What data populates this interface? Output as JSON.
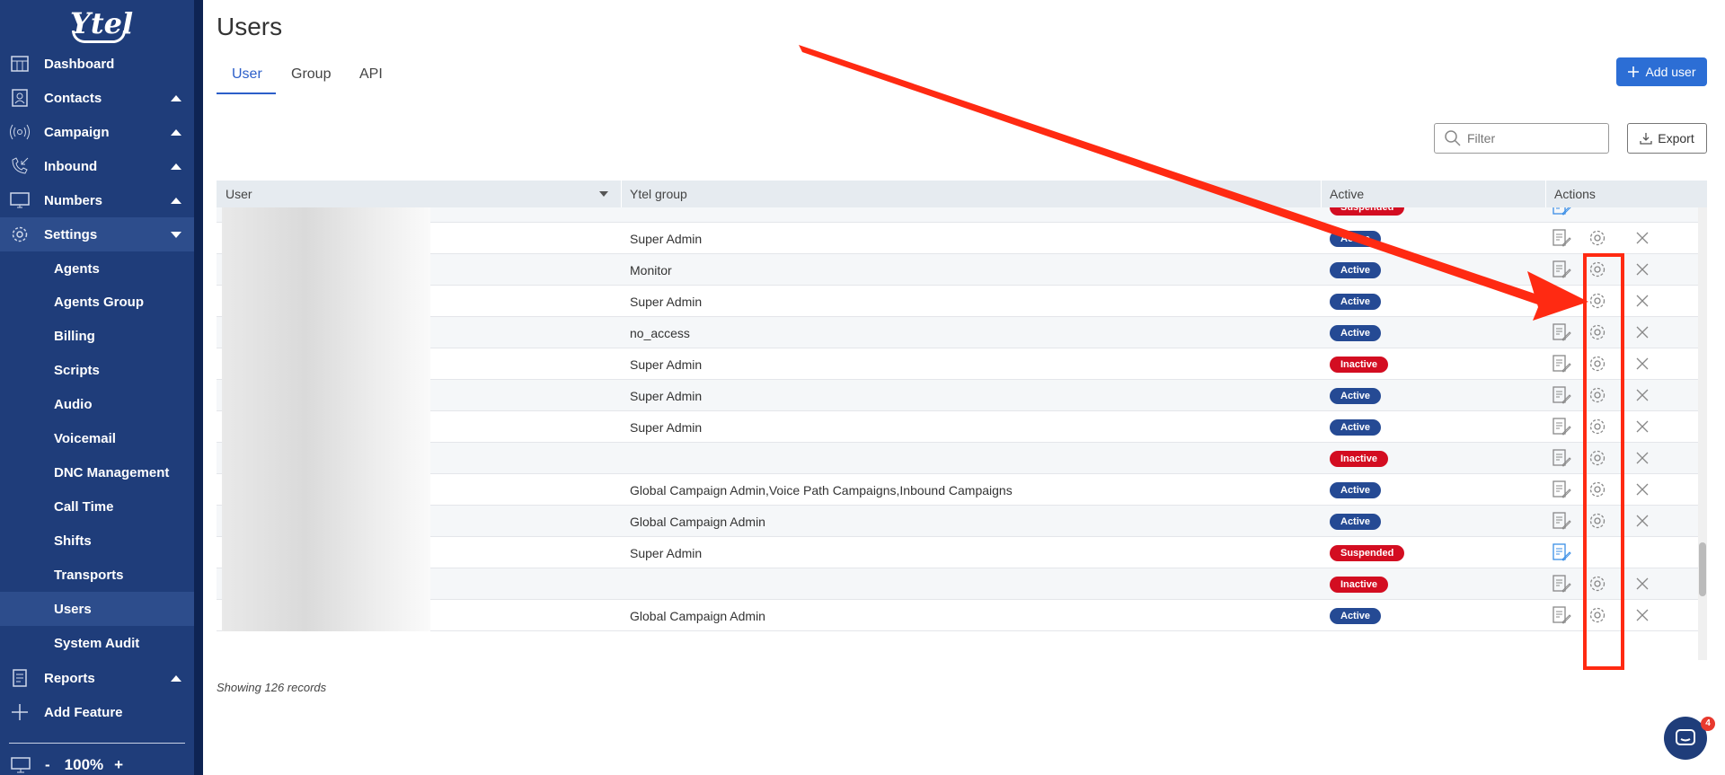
{
  "app": {
    "logo_text": "Ytel"
  },
  "sidebar": {
    "items": [
      {
        "label": "Dashboard",
        "icon": "dashboard-icon"
      },
      {
        "label": "Contacts",
        "icon": "contacts-icon"
      },
      {
        "label": "Campaign",
        "icon": "broadcast-icon"
      },
      {
        "label": "Inbound",
        "icon": "phone-incoming-icon"
      },
      {
        "label": "Numbers",
        "icon": "numbers-icon"
      },
      {
        "label": "Settings",
        "icon": "gear-icon"
      },
      {
        "label": "Reports",
        "icon": "reports-icon"
      },
      {
        "label": "Add Feature",
        "icon": "plus-icon"
      }
    ],
    "settings_sub": [
      "Agents",
      "Agents Group",
      "Billing",
      "Scripts",
      "Audio",
      "Voicemail",
      "DNC Management",
      "Call Time",
      "Shifts",
      "Transports",
      "Users",
      "System Audit"
    ],
    "selected": "Users",
    "zoom": {
      "minus": "-",
      "value": "100%",
      "plus": "+"
    }
  },
  "header": {
    "title": "Users",
    "tabs": [
      "User",
      "Group",
      "API"
    ],
    "add_user_label": "Add user",
    "filter_placeholder": "Filter",
    "export_label": "Export"
  },
  "table": {
    "columns": [
      "User",
      "Ytel group",
      "Active",
      "Actions"
    ],
    "rows": [
      {
        "group": "",
        "status": "Suspended",
        "actions": [
          "edit"
        ]
      },
      {
        "group": "Super Admin",
        "status": "Active",
        "actions": [
          "edit",
          "gear",
          "close"
        ]
      },
      {
        "group": "Monitor",
        "status": "Active",
        "actions": [
          "edit",
          "gear",
          "close"
        ]
      },
      {
        "group": "Super Admin",
        "status": "Active",
        "actions": [
          "edit",
          "gear",
          "close"
        ]
      },
      {
        "group": "no_access",
        "status": "Active",
        "actions": [
          "edit",
          "gear",
          "close"
        ]
      },
      {
        "group": "Super Admin",
        "status": "Inactive",
        "actions": [
          "edit",
          "gear",
          "close"
        ]
      },
      {
        "group": "Super Admin",
        "status": "Active",
        "actions": [
          "edit",
          "gear",
          "close"
        ]
      },
      {
        "group": "Super Admin",
        "status": "Active",
        "actions": [
          "edit",
          "gear",
          "close"
        ]
      },
      {
        "group": "",
        "status": "Inactive",
        "actions": [
          "edit",
          "gear",
          "close"
        ]
      },
      {
        "group": "Global Campaign Admin,Voice Path Campaigns,Inbound Campaigns",
        "status": "Active",
        "actions": [
          "edit",
          "gear",
          "close"
        ]
      },
      {
        "group": "Global Campaign Admin",
        "status": "Active",
        "actions": [
          "edit",
          "gear",
          "close"
        ]
      },
      {
        "group": "Super Admin",
        "status": "Suspended",
        "actions": [
          "edit"
        ]
      },
      {
        "group": "",
        "status": "Inactive",
        "actions": [
          "edit",
          "gear",
          "close"
        ]
      },
      {
        "group": "Global Campaign Admin",
        "status": "Active",
        "actions": [
          "edit",
          "gear",
          "close"
        ]
      }
    ],
    "records_text": "Showing 126 records"
  },
  "chat": {
    "badge_count": "4"
  },
  "colors": {
    "sidebar": "#1f3d7a",
    "accent": "#2c6ed5",
    "active": "#254a94",
    "danger": "#d30d21",
    "annotation": "#ff2a12"
  }
}
